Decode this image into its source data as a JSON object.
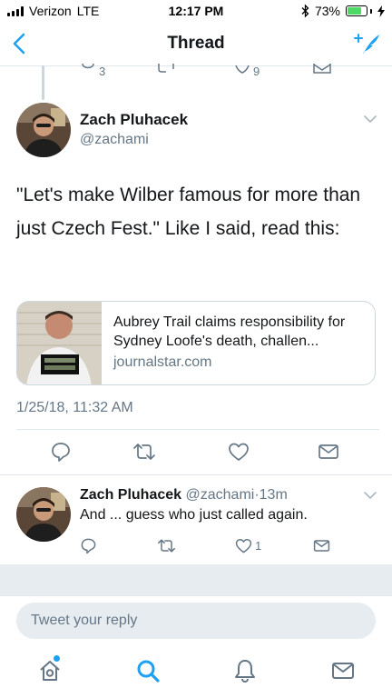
{
  "status_bar": {
    "carrier": "Verizon",
    "network": "LTE",
    "time": "12:17 PM",
    "battery_percent": "73%",
    "battery_level": 0.73
  },
  "nav": {
    "title": "Thread"
  },
  "previous_tweet": {
    "reply_count": "3",
    "retweet_count": "",
    "like_count": "9"
  },
  "main_tweet": {
    "author_name": "Zach Pluhacek",
    "author_handle": "@zachami",
    "text": "\"Let's make Wilber famous for more than just Czech Fest.\" Like I said, read this:",
    "card": {
      "title": "Aubrey Trail claims responsibility for Sydney Loofe's death, challen...",
      "domain": "journalstar.com"
    },
    "timestamp": "1/25/18, 11:32 AM"
  },
  "reply_tweet": {
    "author_name": "Zach Pluhacek",
    "author_handle": "@zachami",
    "separator": "·",
    "time_ago": "13m",
    "text": "And ... guess who just called again.",
    "like_count": "1"
  },
  "reply_box": {
    "placeholder": "Tweet your reply"
  },
  "tabs": [
    "home-icon",
    "search-icon",
    "notifications-icon",
    "messages-icon"
  ],
  "colors": {
    "accent": "#1da1f2",
    "secondary_text": "#657786",
    "divider": "#e1e8ed"
  }
}
